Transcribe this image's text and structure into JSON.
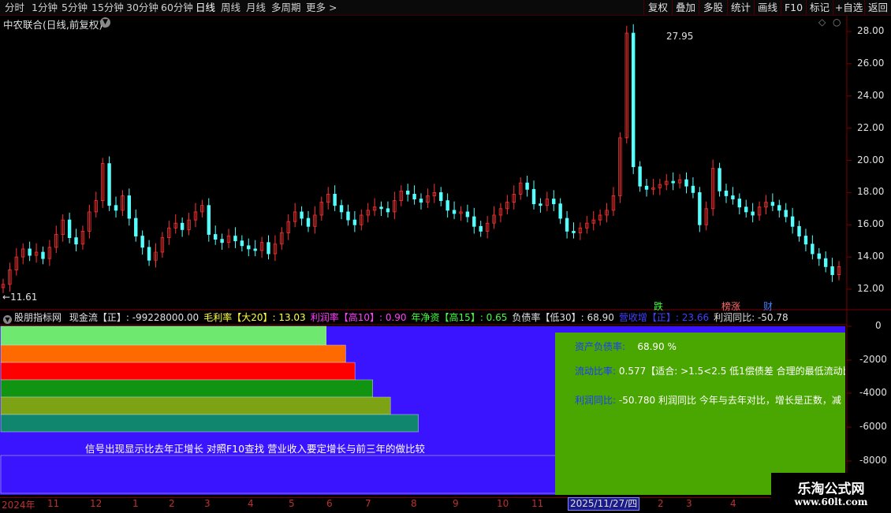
{
  "toolbar": {
    "periods": [
      "分时",
      "1分钟",
      "5分钟",
      "15分钟",
      "30分钟",
      "60分钟",
      "日线",
      "周线",
      "月线",
      "多周期",
      "更多 >"
    ],
    "active_period": "日线",
    "buttons": [
      "复权",
      "叠加",
      "多股",
      "统计",
      "画线",
      "F10",
      "标记",
      "+自选",
      "返回"
    ]
  },
  "stock_title": "中农联合(日线,前复权)",
  "price_axis": [
    "28.00",
    "26.00",
    "24.00",
    "22.00",
    "20.00",
    "18.00",
    "16.00",
    "14.00",
    "12.00"
  ],
  "annotations": {
    "high": "27.95",
    "low": "11.61"
  },
  "event_marks": [
    "跌",
    "榜涨",
    "财"
  ],
  "indicator_line": {
    "name": "股朋指标网",
    "items": [
      {
        "text": "现金流【正】: -99228000.00",
        "color": "#e0e0e0"
      },
      {
        "text": "毛利率【大20】: 13.03",
        "color": "#ffff40"
      },
      {
        "text": "利润率【高10】: 0.90",
        "color": "#ff40ff"
      },
      {
        "text": "年净资【高15】: 0.65",
        "color": "#40ff40"
      },
      {
        "text": "负债率【低30】: 68.90",
        "color": "#e0e0e0"
      },
      {
        "text": "营收增【正】: 23.66",
        "color": "#4040ff"
      },
      {
        "text": "利润同比: -50.78",
        "color": "#e0e0e0"
      }
    ]
  },
  "indicator_axis": [
    "0",
    "-2000",
    "-4000",
    "-6000",
    "-8000"
  ],
  "panel": {
    "r1_key": "资产负债率:",
    "r1_val": "68.90 %",
    "r2_key": "流动比率:",
    "r2_val": "0.577【适合: >1.5<2.5 低1偿债差  合理的最低流动比",
    "r3_key": "利润同比:",
    "r3_val": "-50.780    利润同比 今年与去年对比，增长是正数，减"
  },
  "bar_note": "信号出现显示比去年正增长    对照F10查找 营业收入要定增长与前三年的做比较",
  "bar_colors": [
    "#6ee86e",
    "#ff6a00",
    "#ff0000",
    "#119411",
    "#7ba313",
    "#11866e"
  ],
  "bar_fill_fractions": [
    0.385,
    0.408,
    0.419,
    0.44,
    0.461,
    0.494
  ],
  "dates": [
    "2024年",
    "11",
    "12",
    "1",
    "2",
    "3",
    "4",
    "5",
    "6",
    "7",
    "8",
    "9",
    "10",
    "11",
    "2",
    "3",
    "4"
  ],
  "date_cursor": "2025/11/27/四",
  "logo": {
    "line1": "乐淘公式网",
    "line2": "www.60lt.com"
  },
  "chart_data": {
    "type": "candlestick",
    "ylim": [
      11.0,
      28.8
    ],
    "y_ticks": [
      12,
      14,
      16,
      18,
      20,
      22,
      24,
      26,
      28
    ],
    "close_series": [
      12.3,
      13.2,
      14.0,
      14.5,
      14.1,
      14.3,
      13.9,
      14.6,
      15.4,
      16.3,
      15.2,
      14.8,
      15.6,
      16.8,
      17.5,
      19.8,
      17.2,
      16.9,
      17.8,
      16.4,
      15.3,
      14.6,
      13.8,
      14.3,
      15.2,
      15.8,
      16.1,
      15.7,
      16.3,
      16.8,
      17.2,
      15.4,
      15.1,
      14.9,
      15.3,
      15.0,
      14.7,
      14.5,
      14.4,
      14.9,
      14.2,
      14.8,
      15.5,
      16.2,
      16.8,
      16.4,
      15.9,
      16.6,
      17.4,
      17.9,
      17.2,
      16.8,
      16.3,
      16.0,
      16.6,
      16.9,
      17.1,
      17.0,
      16.8,
      17.5,
      18.1,
      17.9,
      17.6,
      17.4,
      17.8,
      18.0,
      17.5,
      16.9,
      16.7,
      16.8,
      16.5,
      15.9,
      15.6,
      16.1,
      16.6,
      17.0,
      17.4,
      17.9,
      18.6,
      18.2,
      17.3,
      17.2,
      17.6,
      17.3,
      16.4,
      15.6,
      15.5,
      15.8,
      16.1,
      16.3,
      16.6,
      16.9,
      17.8,
      21.4,
      27.9,
      19.6,
      18.4,
      18.2,
      18.3,
      18.5,
      18.7,
      18.6,
      18.8,
      18.4,
      18.0,
      16.0,
      17.0,
      19.5,
      18.1,
      17.8,
      17.6,
      17.1,
      16.8,
      16.6,
      17.1,
      17.4,
      17.2,
      16.9,
      16.5,
      15.9,
      15.3,
      14.8,
      14.2,
      13.9,
      13.4,
      12.9,
      13.4
    ]
  }
}
